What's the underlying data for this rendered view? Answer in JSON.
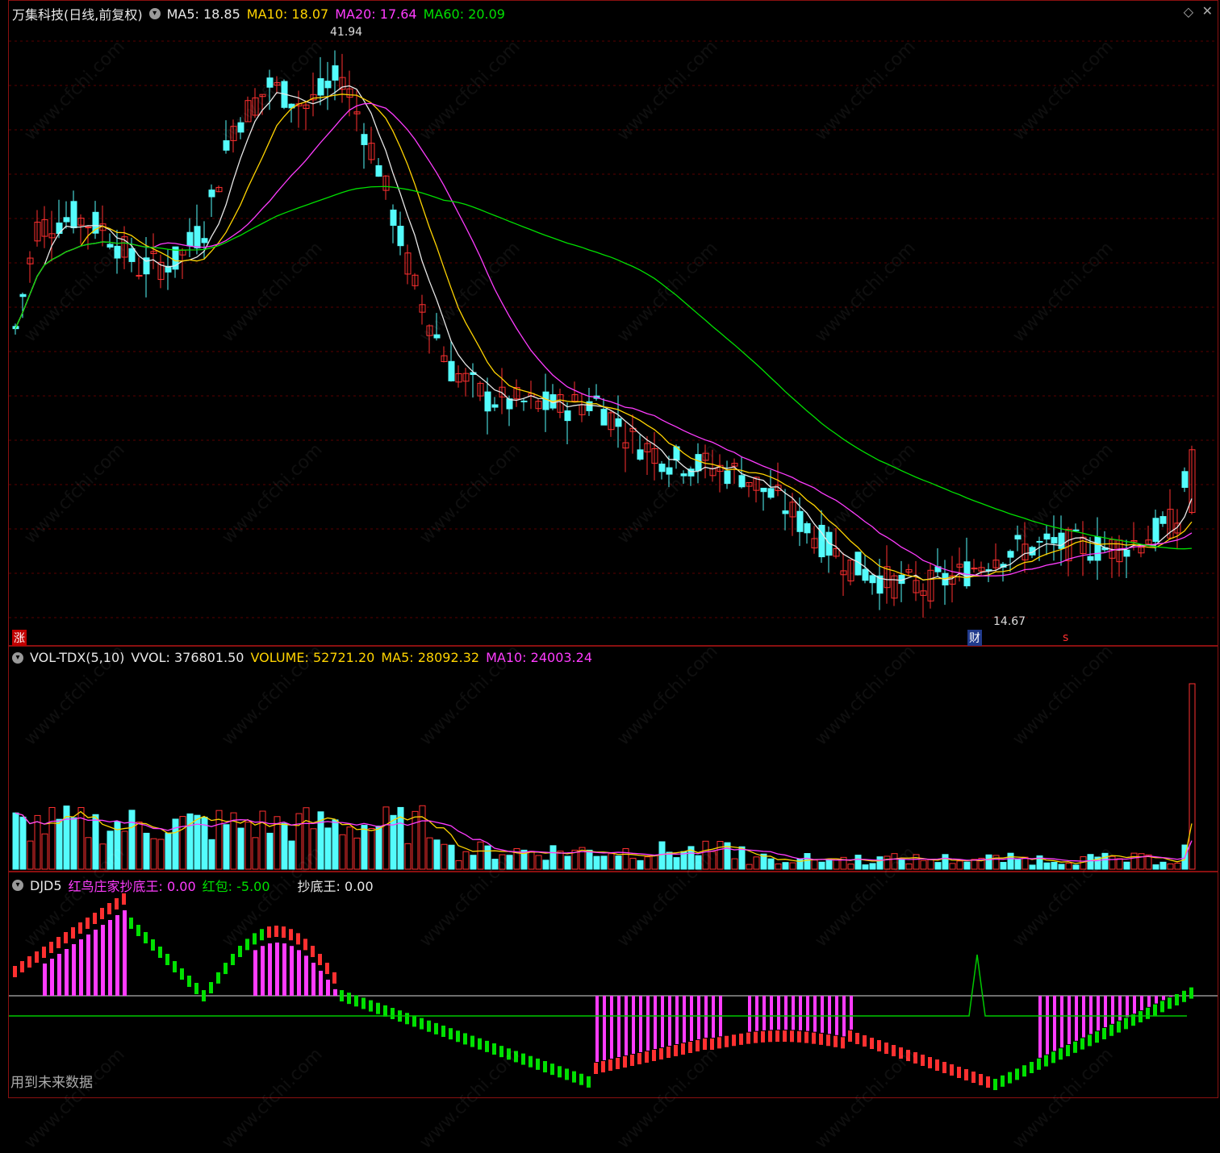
{
  "main": {
    "title": "万集科技(日线,前复权)",
    "ma5": "MA5: 18.85",
    "ma10": "MA10: 18.07",
    "ma20": "MA20: 17.64",
    "ma60": "MA60: 20.09",
    "high_label": "41.94",
    "low_label": "14.67",
    "zhang_tag": "涨",
    "cai_tag": "财",
    "s_tag": "s"
  },
  "vol": {
    "name": "VOL-TDX(5,10)",
    "vvol": "VVOL: 376801.50",
    "volume": "VOLUME: 52721.20",
    "ma5": "MA5: 28092.32",
    "ma10": "MA10: 24003.24"
  },
  "ind": {
    "name": "DJD5",
    "v1": "红鸟庄家抄底王: 0.00",
    "v2": "红包: -5.00",
    "v3": "抄底王: 0.00",
    "footer": "用到未来数据"
  },
  "watermark": "www.cfchi.com",
  "colors": {
    "up": "#ff3030",
    "down": "#54fcfc",
    "ma5": "#e8e8e8",
    "ma10": "#ffd400",
    "ma20": "#ff3cff",
    "ma60": "#00e000"
  }
}
